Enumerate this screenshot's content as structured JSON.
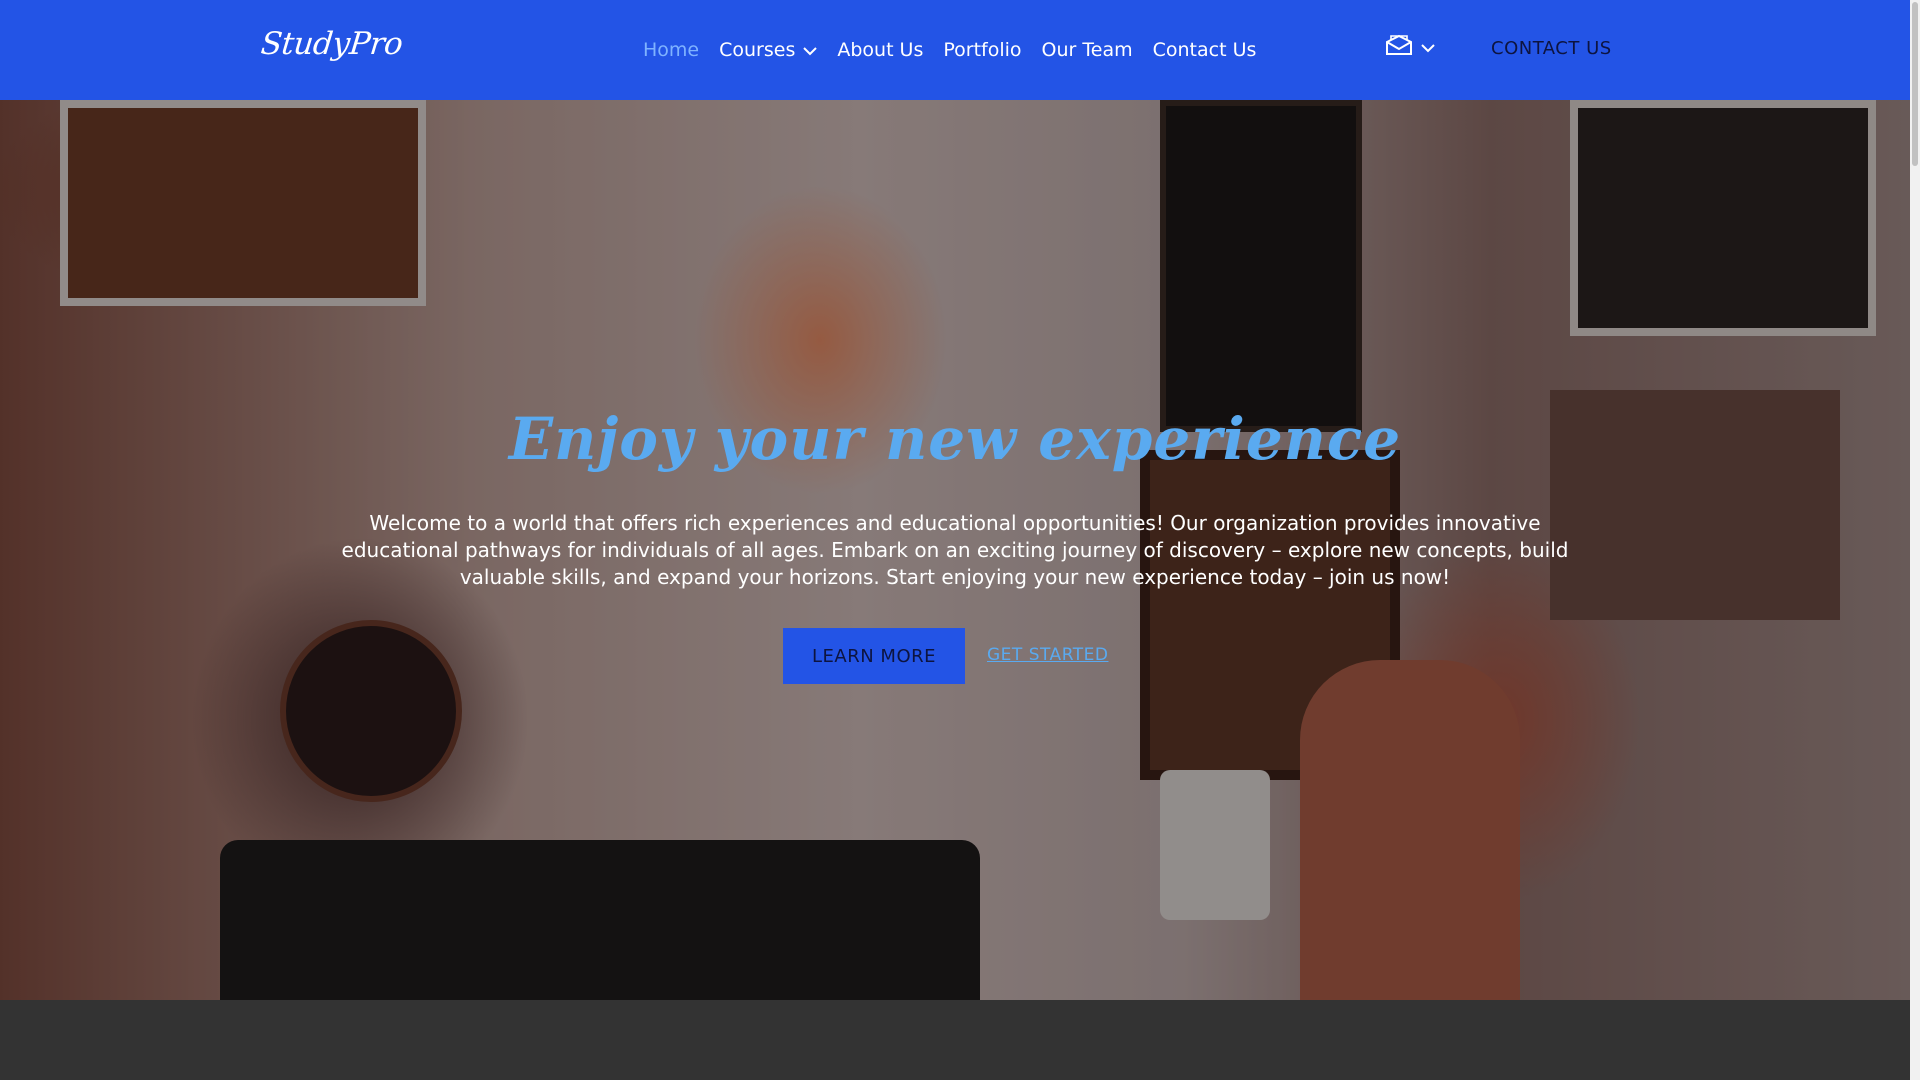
{
  "brand": {
    "logo": "StudyPro"
  },
  "nav": {
    "items": [
      {
        "label": "Home",
        "active": true
      },
      {
        "label": "Courses",
        "has_dropdown": true
      },
      {
        "label": "About Us"
      },
      {
        "label": "Portfolio"
      },
      {
        "label": "Our Team"
      },
      {
        "label": "Contact Us"
      }
    ],
    "mail_icon": "envelope-open-icon",
    "mail_dropdown_icon": "chevron-down-icon",
    "cta_label": "CONTACT US"
  },
  "hero": {
    "title": "Enjoy your new experience",
    "text": "Welcome to a world that offers rich experiences and educational opportunities! Our organization provides innovative educational pathways for individuals of all ages. Embark on an exciting journey of discovery – explore new concepts, build valuable skills, and expand your horizons. Start enjoying your new experience today – join us now!",
    "primary_button": "LEARN MORE",
    "secondary_link": "GET STARTED"
  },
  "colors": {
    "navbar": "#2354E6",
    "accent": "#5aaaf0",
    "dark": "#0d1440",
    "footer_band": "#333333"
  }
}
